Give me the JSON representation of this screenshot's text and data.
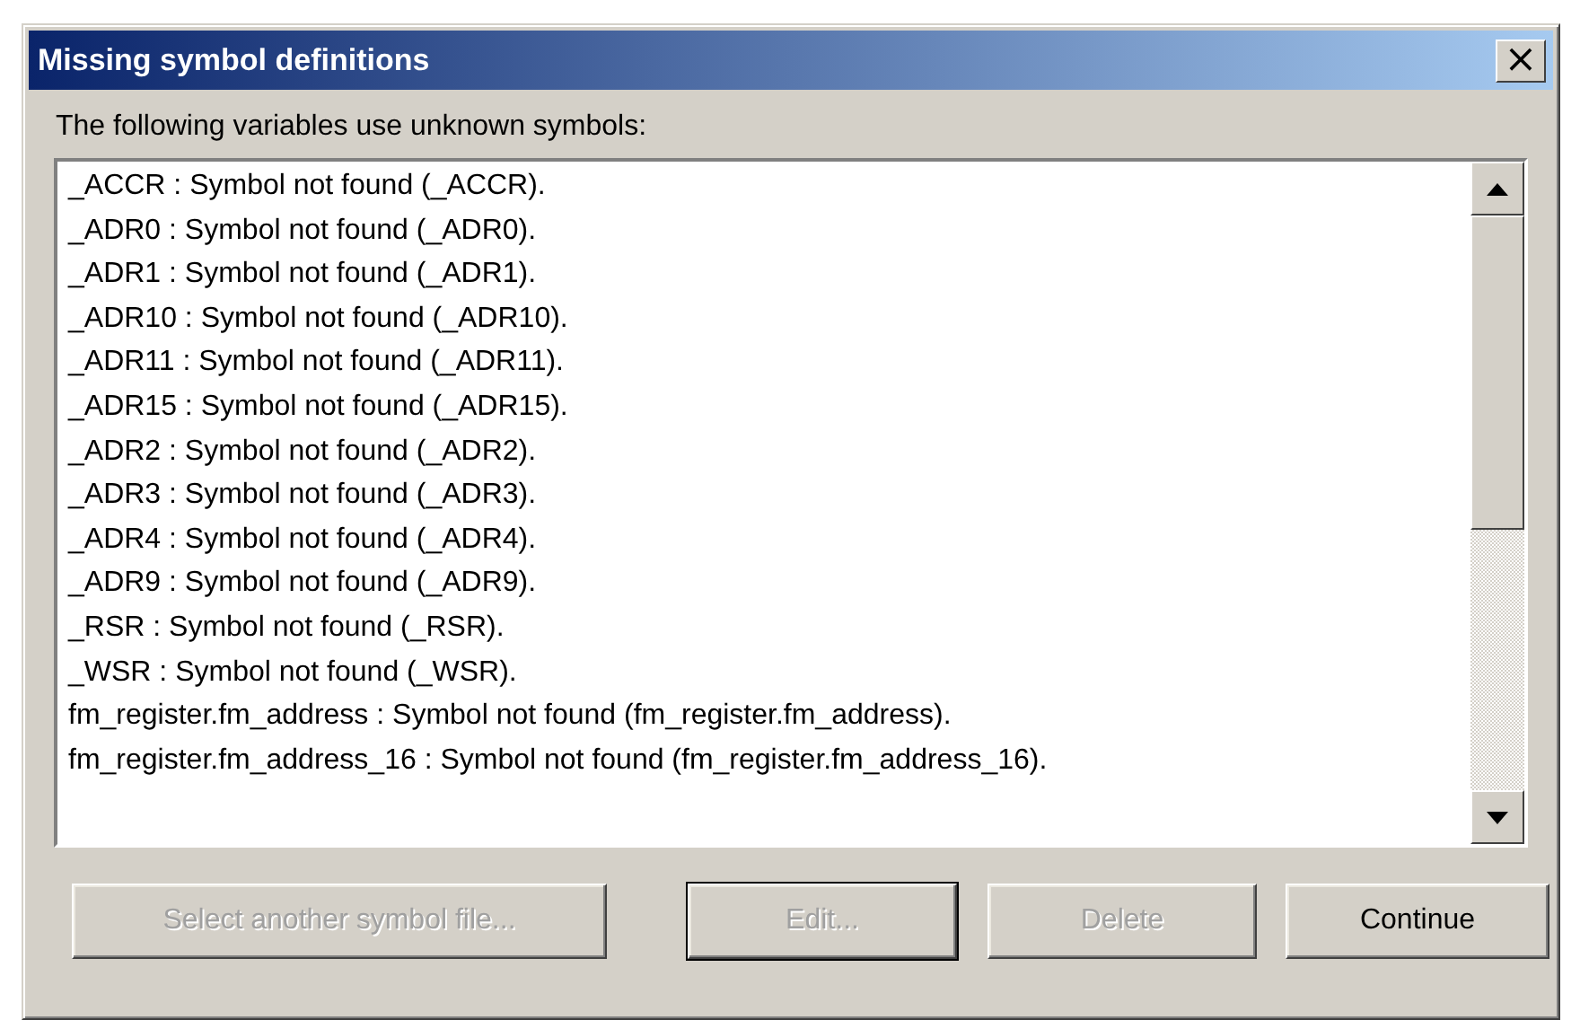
{
  "window": {
    "title": "Missing symbol definitions",
    "close": "×"
  },
  "prompt": "The following variables use unknown symbols:",
  "list": {
    "items": [
      "_ACCR : Symbol not found (_ACCR).",
      "_ADR0 : Symbol not found (_ADR0).",
      "_ADR1 : Symbol not found (_ADR1).",
      "_ADR10 : Symbol not found (_ADR10).",
      "_ADR11 : Symbol not found (_ADR11).",
      "_ADR15 : Symbol not found (_ADR15).",
      "_ADR2 : Symbol not found (_ADR2).",
      "_ADR3 : Symbol not found (_ADR3).",
      "_ADR4 : Symbol not found (_ADR4).",
      "_ADR9 : Symbol not found (_ADR9).",
      "_RSR : Symbol not found (_RSR).",
      "_WSR : Symbol not found (_WSR).",
      "fm_register.fm_address : Symbol not found (fm_register.fm_address).",
      "fm_register.fm_address_16 : Symbol not found (fm_register.fm_address_16)."
    ]
  },
  "buttons": [
    {
      "label": "Select another symbol file...",
      "disabled": true,
      "default": false
    },
    {
      "label": "Edit...",
      "disabled": true,
      "default": true
    },
    {
      "label": "Delete",
      "disabled": true,
      "default": false
    },
    {
      "label": "Continue",
      "disabled": false,
      "default": false
    }
  ]
}
